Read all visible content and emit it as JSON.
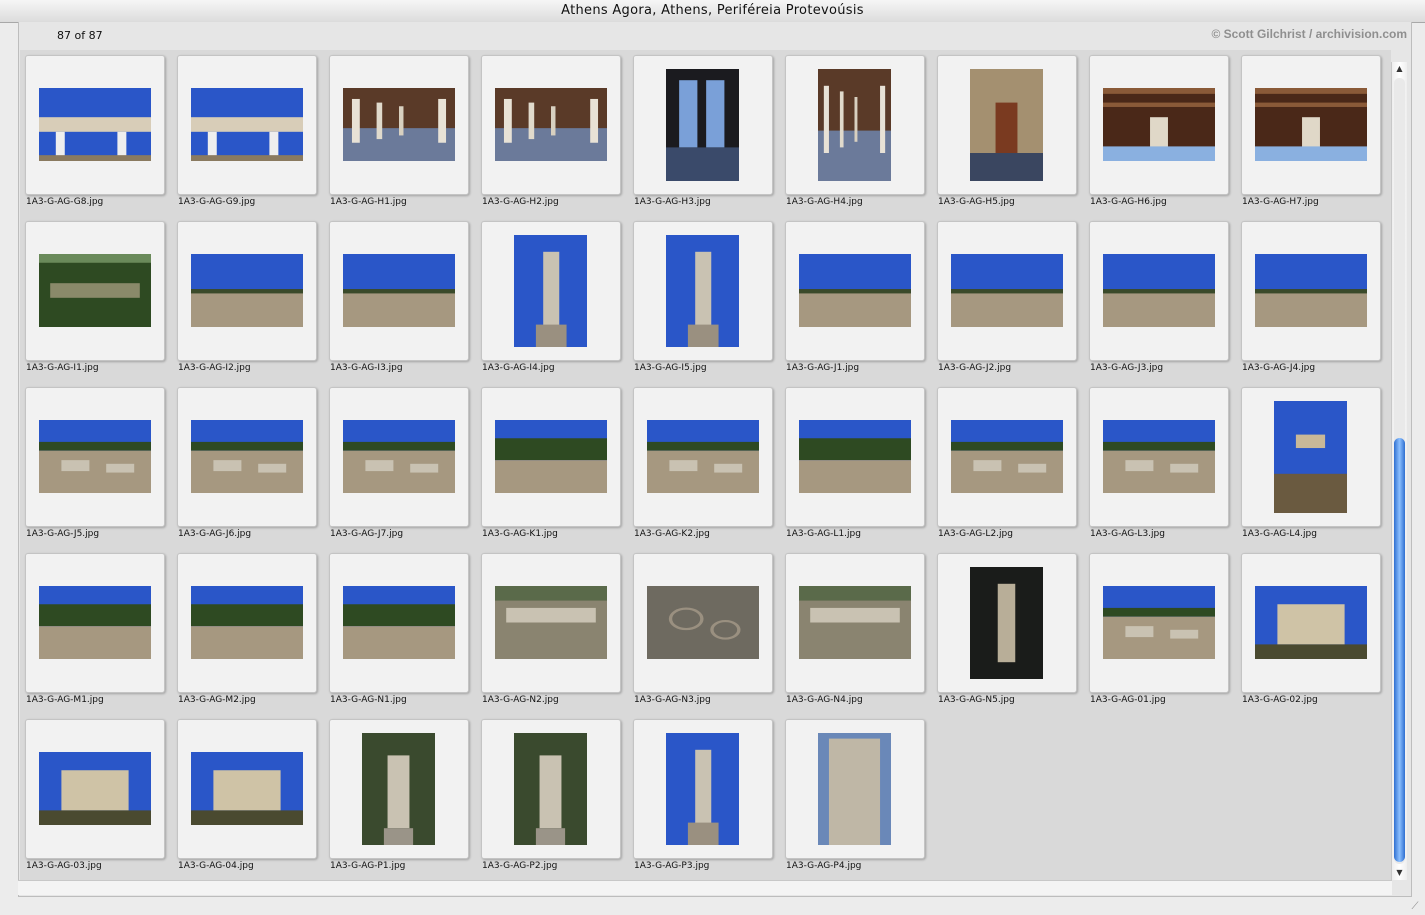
{
  "window": {
    "title": "Athens Agora, Athens, Periféreia Protevoúsis",
    "count_label": "87 of 87",
    "copyright": "© Scott Gilchrist / archivision.com"
  },
  "thumbnails": [
    {
      "name": "1A3-G-AG-G8.jpg",
      "orientation": "landscape",
      "scene": "sky-building"
    },
    {
      "name": "1A3-G-AG-G9.jpg",
      "orientation": "landscape",
      "scene": "sky-building"
    },
    {
      "name": "1A3-G-AG-H1.jpg",
      "orientation": "landscape",
      "scene": "colonnade"
    },
    {
      "name": "1A3-G-AG-H2.jpg",
      "orientation": "landscape",
      "scene": "colonnade"
    },
    {
      "name": "1A3-G-AG-H3.jpg",
      "orientation": "portrait",
      "scene": "dark-interior"
    },
    {
      "name": "1A3-G-AG-H4.jpg",
      "orientation": "portrait",
      "scene": "colonnade"
    },
    {
      "name": "1A3-G-AG-H5.jpg",
      "orientation": "portrait",
      "scene": "doorway"
    },
    {
      "name": "1A3-G-AG-H6.jpg",
      "orientation": "landscape",
      "scene": "ceiling"
    },
    {
      "name": "1A3-G-AG-H7.jpg",
      "orientation": "landscape",
      "scene": "ceiling"
    },
    {
      "name": "1A3-G-AG-I1.jpg",
      "orientation": "landscape",
      "scene": "green-ruins"
    },
    {
      "name": "1A3-G-AG-I2.jpg",
      "orientation": "landscape",
      "scene": "sky-ground"
    },
    {
      "name": "1A3-G-AG-I3.jpg",
      "orientation": "landscape",
      "scene": "sky-ground"
    },
    {
      "name": "1A3-G-AG-I4.jpg",
      "orientation": "portrait",
      "scene": "statue-sky"
    },
    {
      "name": "1A3-G-AG-I5.jpg",
      "orientation": "portrait",
      "scene": "statue-sky"
    },
    {
      "name": "1A3-G-AG-J1.jpg",
      "orientation": "landscape",
      "scene": "sky-ground"
    },
    {
      "name": "1A3-G-AG-J2.jpg",
      "orientation": "landscape",
      "scene": "sky-ground"
    },
    {
      "name": "1A3-G-AG-J3.jpg",
      "orientation": "landscape",
      "scene": "sky-ground"
    },
    {
      "name": "1A3-G-AG-J4.jpg",
      "orientation": "landscape",
      "scene": "sky-ground"
    },
    {
      "name": "1A3-G-AG-J5.jpg",
      "orientation": "landscape",
      "scene": "sky-ruins"
    },
    {
      "name": "1A3-G-AG-J6.jpg",
      "orientation": "landscape",
      "scene": "sky-ruins"
    },
    {
      "name": "1A3-G-AG-J7.jpg",
      "orientation": "landscape",
      "scene": "sky-ruins"
    },
    {
      "name": "1A3-G-AG-K1.jpg",
      "orientation": "landscape",
      "scene": "sky-trees"
    },
    {
      "name": "1A3-G-AG-K2.jpg",
      "orientation": "landscape",
      "scene": "sky-ruins"
    },
    {
      "name": "1A3-G-AG-L1.jpg",
      "orientation": "landscape",
      "scene": "sky-trees"
    },
    {
      "name": "1A3-G-AG-L2.jpg",
      "orientation": "landscape",
      "scene": "sky-ruins"
    },
    {
      "name": "1A3-G-AG-L3.jpg",
      "orientation": "landscape",
      "scene": "sky-ruins"
    },
    {
      "name": "1A3-G-AG-L4.jpg",
      "orientation": "portrait",
      "scene": "temple-sky"
    },
    {
      "name": "1A3-G-AG-M1.jpg",
      "orientation": "landscape",
      "scene": "sky-trees"
    },
    {
      "name": "1A3-G-AG-M2.jpg",
      "orientation": "landscape",
      "scene": "sky-trees"
    },
    {
      "name": "1A3-G-AG-N1.jpg",
      "orientation": "landscape",
      "scene": "sky-trees"
    },
    {
      "name": "1A3-G-AG-N2.jpg",
      "orientation": "landscape",
      "scene": "stone-ruins"
    },
    {
      "name": "1A3-G-AG-N3.jpg",
      "orientation": "landscape",
      "scene": "mosaic"
    },
    {
      "name": "1A3-G-AG-N4.jpg",
      "orientation": "landscape",
      "scene": "stone-ruins"
    },
    {
      "name": "1A3-G-AG-N5.jpg",
      "orientation": "portrait",
      "scene": "dark-stone"
    },
    {
      "name": "1A3-G-AG-01.jpg",
      "orientation": "landscape",
      "scene": "sky-ruins"
    },
    {
      "name": "1A3-G-AG-02.jpg",
      "orientation": "landscape",
      "scene": "capital"
    },
    {
      "name": "1A3-G-AG-03.jpg",
      "orientation": "landscape",
      "scene": "capital"
    },
    {
      "name": "1A3-G-AG-04.jpg",
      "orientation": "landscape",
      "scene": "capital"
    },
    {
      "name": "1A3-G-AG-P1.jpg",
      "orientation": "portrait",
      "scene": "statue-trees"
    },
    {
      "name": "1A3-G-AG-P2.jpg",
      "orientation": "portrait",
      "scene": "statue-trees"
    },
    {
      "name": "1A3-G-AG-P3.jpg",
      "orientation": "portrait",
      "scene": "statue-sky"
    },
    {
      "name": "1A3-G-AG-P4.jpg",
      "orientation": "portrait",
      "scene": "statue-close"
    }
  ],
  "colors": {
    "sky": "#2a56c8",
    "ground": "#a69880",
    "tree": "#2e4a22",
    "stone": "#c9c2b2",
    "dark": "#1b1b1f",
    "scrollbar": "#3a7be0"
  }
}
